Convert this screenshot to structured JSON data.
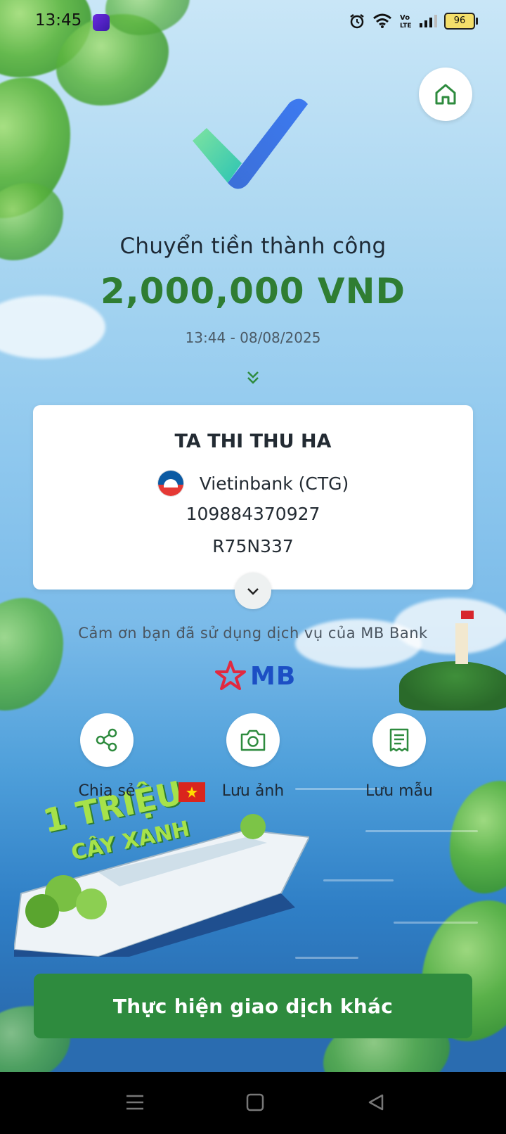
{
  "status_bar": {
    "time": "13:45",
    "battery": "96",
    "icons": [
      "alarm-icon",
      "wifi-icon",
      "volte-icon",
      "signal-icon",
      "battery-icon"
    ]
  },
  "header": {
    "home_icon": "home-icon"
  },
  "result": {
    "title": "Chuyển tiền thành công",
    "amount": "2,000,000 VND",
    "datetime": "13:44 - 08/08/2025"
  },
  "recipient_card": {
    "name": "TA THI THU HA",
    "bank": "Vietinbank (CTG)",
    "account_number": "109884370927",
    "reference": "R75N337"
  },
  "footer": {
    "thanks": "Cảm ơn bạn đã sử dụng dịch vụ của MB Bank",
    "brand": "MB"
  },
  "actions": [
    {
      "label": "Chia sẻ",
      "icon": "share-icon"
    },
    {
      "label": "Lưu ảnh",
      "icon": "camera-icon"
    },
    {
      "label": "Lưu mẫu",
      "icon": "receipt-icon"
    }
  ],
  "promo": {
    "line1": "1 TRIỆU",
    "line2": "CÂY XANH"
  },
  "cta": {
    "label": "Thực hiện giao dịch khác"
  },
  "colors": {
    "accent_green": "#2e8b3e",
    "amount_green": "#2f7d32",
    "mb_blue": "#1c4fc4",
    "mb_red": "#e2293f"
  }
}
